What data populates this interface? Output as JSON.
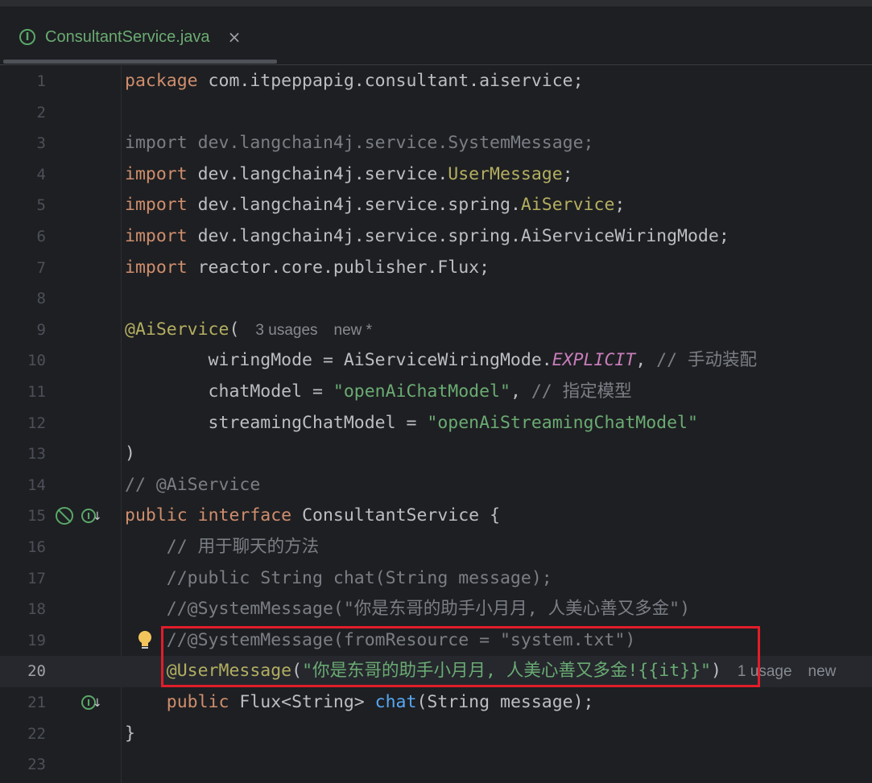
{
  "tab": {
    "title": "ConsultantService.java",
    "icon": "interface-icon",
    "close_label": "×",
    "badge_letter": "I"
  },
  "hints": {
    "ann_usages": "3 usages",
    "ann_new": "new *",
    "line20_usages": "1 usage",
    "line20_new": "new"
  },
  "line_numbers": [
    "1",
    "2",
    "3",
    "4",
    "5",
    "6",
    "7",
    "8",
    "9",
    "10",
    "11",
    "12",
    "13",
    "14",
    "15",
    "16",
    "17",
    "18",
    "19",
    "20",
    "21",
    "22",
    "23"
  ],
  "code": {
    "l1": {
      "kw": "package",
      "rest": " com.itpeppapig.consultant.aiservice;"
    },
    "l3": {
      "kw": "import",
      "rest": " dev.langchain4j.service.SystemMessage;"
    },
    "l4": {
      "kw": "import",
      "pre": " dev.langchain4j.service.",
      "cls": "UserMessage",
      "post": ";"
    },
    "l5": {
      "kw": "import",
      "pre": " dev.langchain4j.service.spring.",
      "cls": "AiService",
      "post": ";"
    },
    "l6": {
      "kw": "import",
      "rest": " dev.langchain4j.service.spring.AiServiceWiringMode;"
    },
    "l7": {
      "kw": "import",
      "rest": " reactor.core.publisher.Flux;"
    },
    "l9": {
      "ann": "@AiService",
      "paren": "("
    },
    "l10": {
      "pre": "        wiringMode = AiServiceWiringMode.",
      "cnst": "EXPLICIT",
      "comma": ", ",
      "cmt": "// 手动装配"
    },
    "l11": {
      "pre": "        chatModel = ",
      "str": "\"openAiChatModel\"",
      "comma": ", ",
      "cmt": "// 指定模型"
    },
    "l12": {
      "pre": "        streamingChatModel = ",
      "str": "\"openAiStreamingChatModel\""
    },
    "l13": {
      "text": ")"
    },
    "l14": {
      "cmt": "// @AiService"
    },
    "l15": {
      "kw1": "public",
      "kw2": "interface",
      "rest": " ConsultantService {"
    },
    "l16": {
      "cmt": "    // 用于聊天的方法"
    },
    "l17": {
      "cmt": "    //public String chat(String message);"
    },
    "l18": {
      "cmt": "    //@SystemMessage(\"你是东哥的助手小月月, 人美心善又多金\")"
    },
    "l19": {
      "cmt": "    //@SystemMessage(fromResource = \"system.txt\")"
    },
    "l20": {
      "indent": "    ",
      "ann": "@UserMessage",
      "open": "(",
      "str": "\"你是东哥的助手小月月, 人美心善又多金!{{it}}\"",
      "close": ")"
    },
    "l21": {
      "indent": "    ",
      "kw": "public",
      "pre": " Flux<String> ",
      "fn": "chat",
      "post": "(String message);"
    },
    "l22": {
      "text": "}"
    }
  },
  "colors": {
    "highlight_box": "#e21d2a",
    "keyword": "#cf8e6d",
    "annotation": "#b3ae60",
    "string": "#6aab73",
    "comment": "#7a7e85"
  }
}
